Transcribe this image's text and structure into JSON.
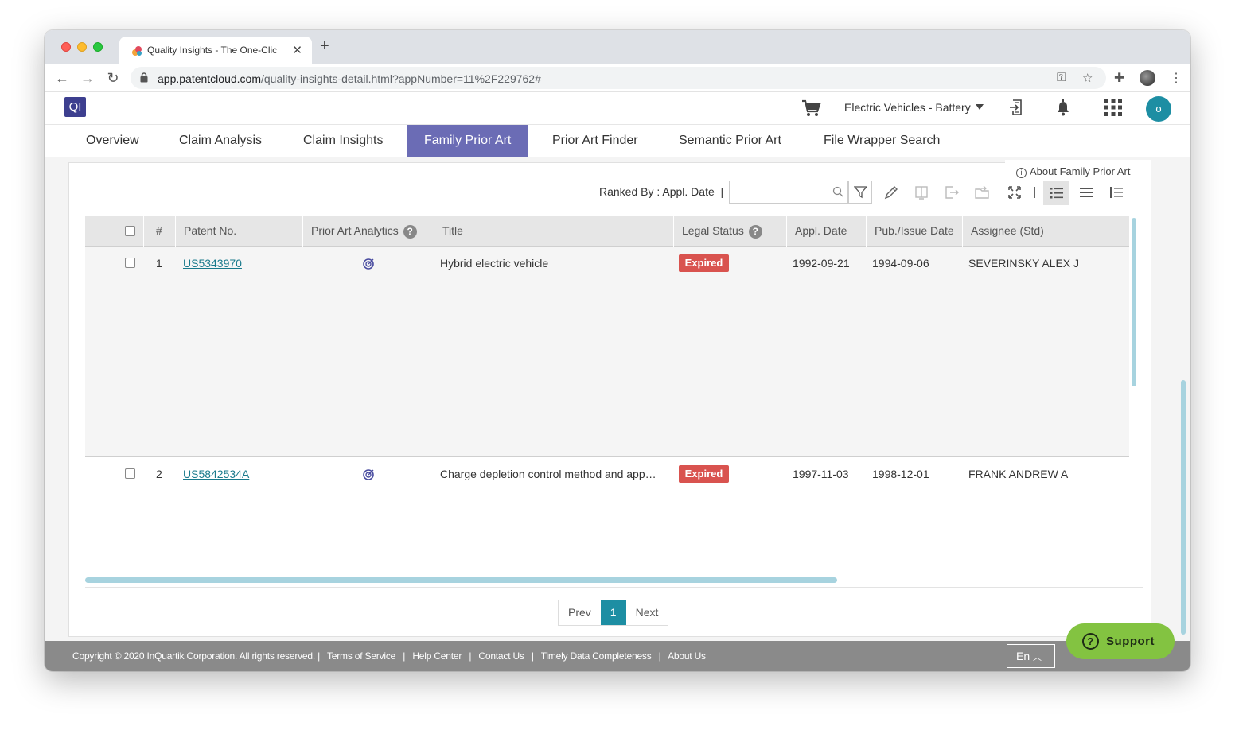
{
  "browser": {
    "tab_title": "Quality Insights - The One-Clic",
    "url_host": "app.patentcloud.com",
    "url_path": "/quality-insights-detail.html?appNumber=11%2F229762#"
  },
  "header": {
    "logo": "QI",
    "workspace": "Electric Vehicles - Battery",
    "avatar_initial": "o"
  },
  "tabs": [
    {
      "label": "Overview"
    },
    {
      "label": "Claim Analysis"
    },
    {
      "label": "Claim Insights"
    },
    {
      "label": "Family Prior Art"
    },
    {
      "label": "Prior Art Finder"
    },
    {
      "label": "Semantic Prior Art"
    },
    {
      "label": "File Wrapper Search"
    }
  ],
  "active_tab": "Family Prior Art",
  "toolbar": {
    "about": "About Family Prior Art",
    "ranked_by": "Ranked By : Appl. Date",
    "search_value": ""
  },
  "table": {
    "columns": [
      "#",
      "Patent No.",
      "Prior Art Analytics",
      "Title",
      "Legal Status",
      "Appl. Date",
      "Pub./Issue Date",
      "Assignee (Std)"
    ],
    "rows": [
      {
        "num": "1",
        "patent": "US5343970",
        "title": "Hybrid electric vehicle",
        "status": "Expired",
        "appl_date": "1992-09-21",
        "pub_date": "1994-09-06",
        "assignee": "SEVERINSKY ALEX J"
      },
      {
        "num": "2",
        "patent": "US5842534A",
        "title": "Charge depletion control method and app…",
        "status": "Expired",
        "appl_date": "1997-11-03",
        "pub_date": "1998-12-01",
        "assignee": "FRANK ANDREW A"
      }
    ]
  },
  "pagination": {
    "prev": "Prev",
    "current": "1",
    "next": "Next"
  },
  "footer": {
    "copyright": "Copyright © 2020 InQuartik Corporation. All rights reserved. |",
    "links": [
      "Terms of Service",
      "|",
      "Help Center",
      "|",
      "Contact Us",
      "|",
      "Timely Data Completeness",
      "|",
      "About Us"
    ],
    "language": "En"
  },
  "support": "Support",
  "colors": {
    "active_tab": "#6b6cb5",
    "accent": "#1d8ea3",
    "expired": "#d9534f",
    "support": "#83c341",
    "footer": "#8a8a8a"
  }
}
